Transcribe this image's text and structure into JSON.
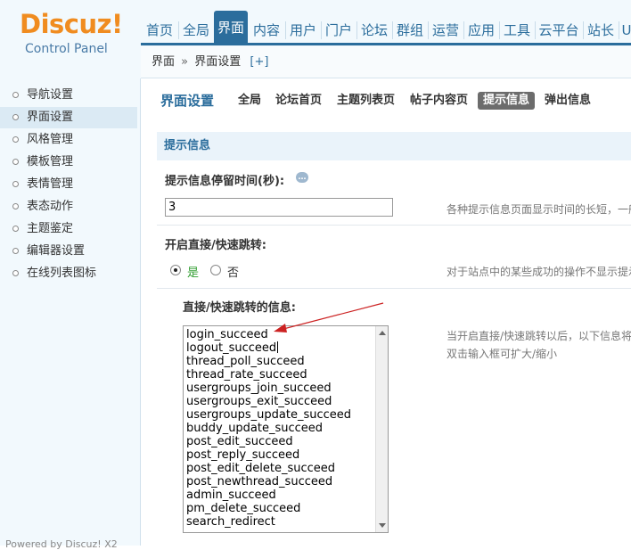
{
  "logo": {
    "title": "Discuz!",
    "subtitle": "Control Panel"
  },
  "topnav": {
    "items": [
      "首页",
      "全局",
      "界面",
      "内容",
      "用户",
      "门户",
      "论坛",
      "群组",
      "运营",
      "应用",
      "工具",
      "云平台",
      "站长",
      "U"
    ],
    "active": "界面"
  },
  "breadcrumb": {
    "root": "界面",
    "sep": "»",
    "current": "界面设置",
    "plus": "[+]"
  },
  "sidebar": {
    "items": [
      "导航设置",
      "界面设置",
      "风格管理",
      "模板管理",
      "表情管理",
      "表态动作",
      "主题鉴定",
      "编辑器设置",
      "在线列表图标"
    ],
    "active": "界面设置",
    "footer": "Powered by Discuz! X2"
  },
  "main": {
    "title": "界面设置",
    "subtabs": [
      "全局",
      "论坛首页",
      "主题列表页",
      "帖子内容页",
      "提示信息",
      "弹出信息"
    ],
    "active_subtab": "提示信息",
    "section_title": "提示信息",
    "delay": {
      "label": "提示信息停留时间(秒):",
      "value": "3",
      "hint": "各种提示信息页面显示时间的长短，一般"
    },
    "quick_jump": {
      "label": "开启直接/快速跳转:",
      "yes": "是",
      "no": "否",
      "selected": "是",
      "hint": "对于站点中的某些成功的操作不显示提示"
    },
    "messages": {
      "label": "直接/快速跳转的信息:",
      "lines": [
        "login_succeed",
        "logout_succeed",
        "thread_poll_succeed",
        "thread_rate_succeed",
        "usergroups_join_succeed",
        "usergroups_exit_succeed",
        "usergroups_update_succeed",
        "buddy_update_succeed",
        "post_edit_succeed",
        "post_reply_succeed",
        "post_edit_delete_succeed",
        "post_newthread_succeed",
        "admin_succeed",
        "pm_delete_succeed",
        "search_redirect"
      ],
      "hint1": "当开启直接/快速跳转以后，以下信息将",
      "hint2": "双击输入框可扩大/缩小"
    }
  },
  "colors": {
    "accent": "#2b6d9c",
    "logo": "#f08c20",
    "annotation_arrow": "#cc2222"
  }
}
